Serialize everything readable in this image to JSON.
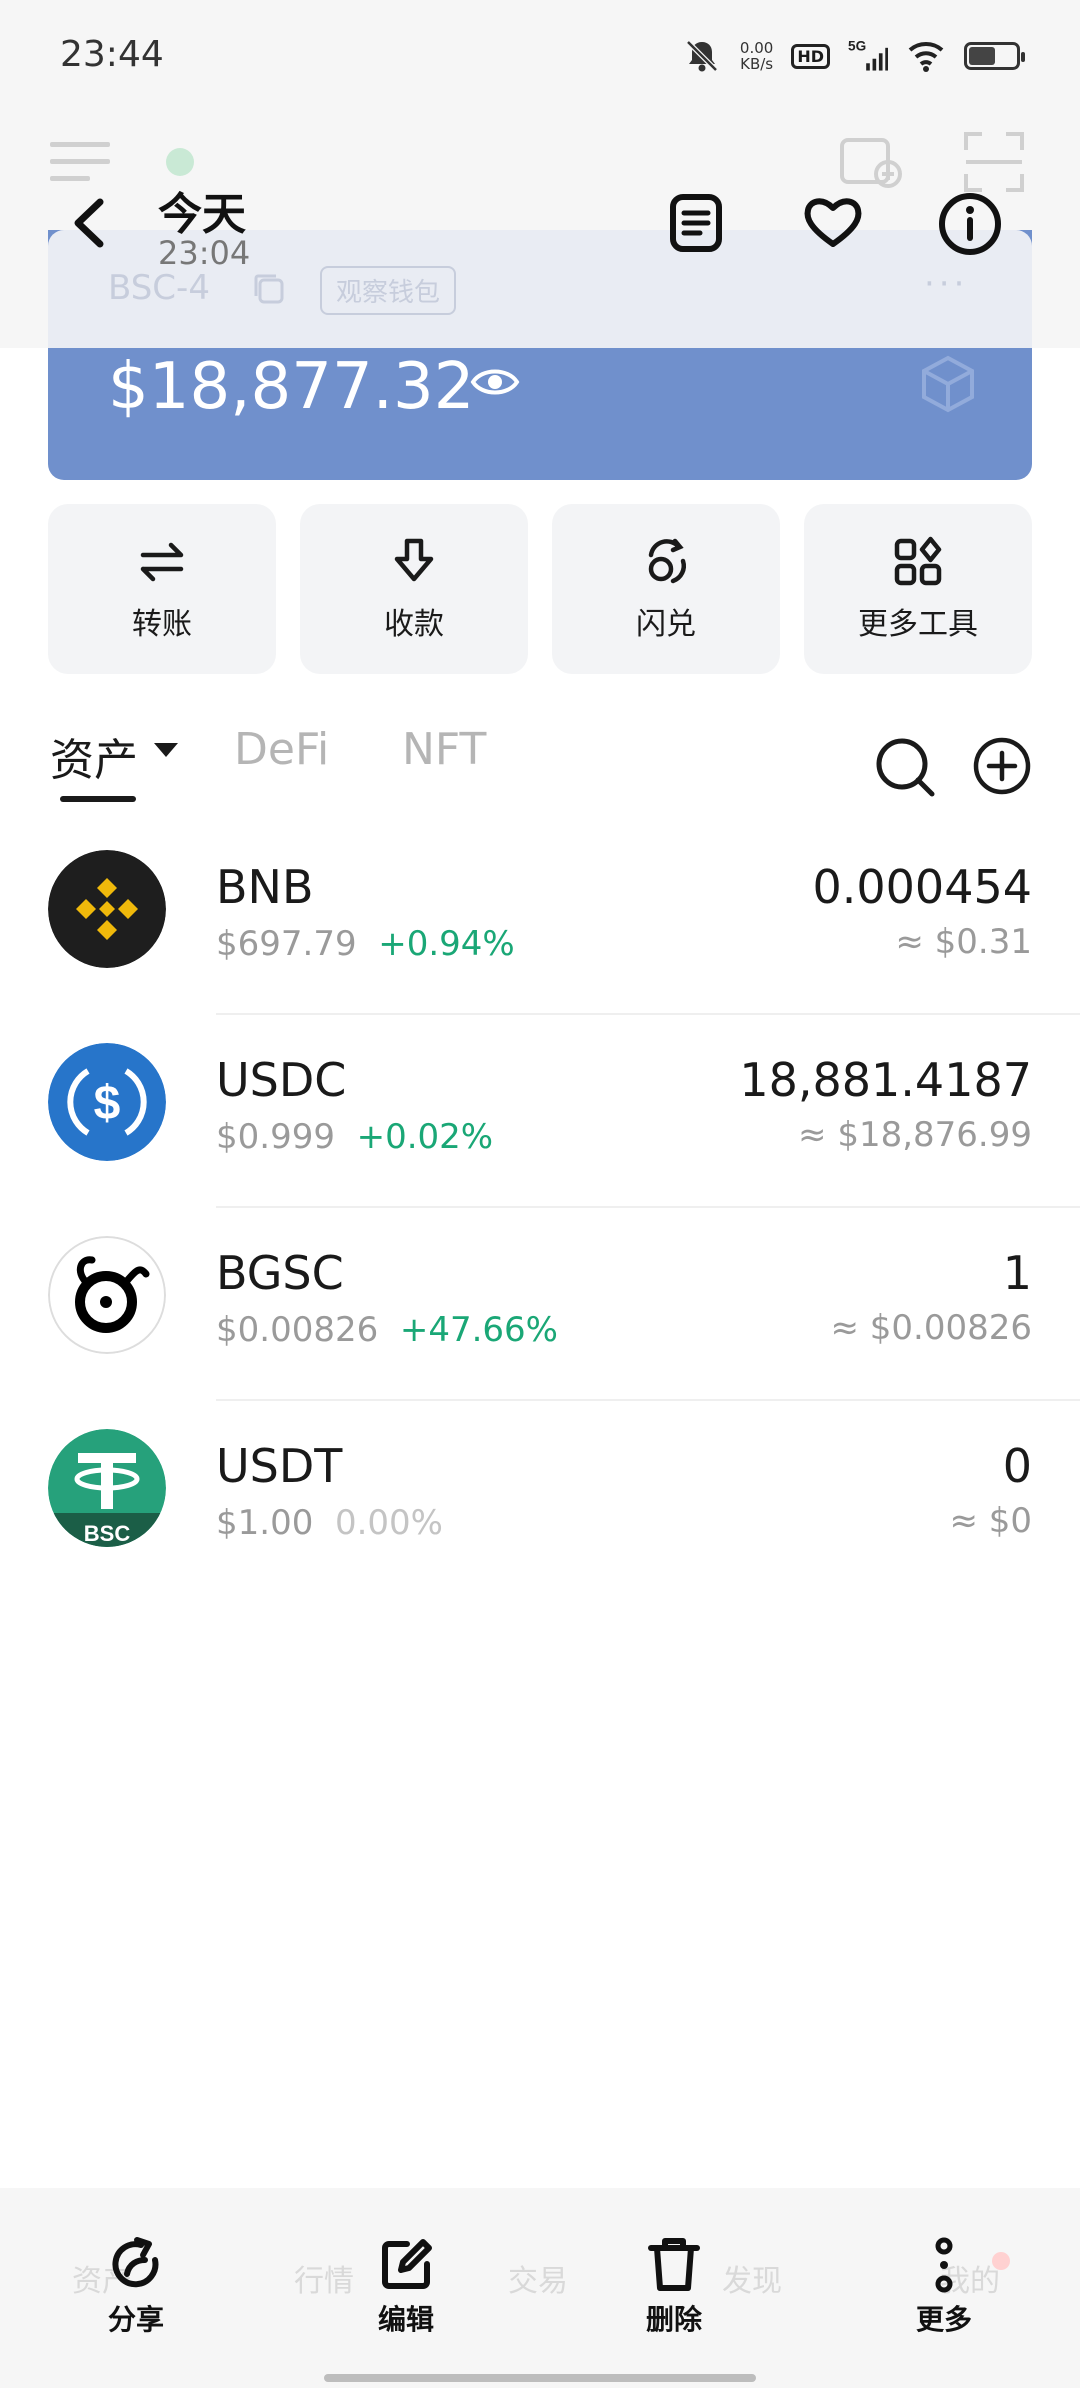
{
  "status_bar": {
    "time": "23:44",
    "net_speed_value": "0.00",
    "net_speed_unit": "KB/s",
    "hd_label": "HD",
    "network_label": "5G",
    "icons": [
      "mute-bell-icon",
      "wifi-icon",
      "battery-icon"
    ],
    "battery_level": 0.6
  },
  "overlay_header": {
    "title": "今天",
    "time": "23:04",
    "icons": [
      "back-icon",
      "note-icon",
      "heart-icon",
      "info-icon"
    ]
  },
  "wallet_card": {
    "name": "BSC-4",
    "badge": "观察钱包",
    "more": "···",
    "balance": "$18,877.32",
    "card_color": "#7090cc"
  },
  "quick_actions": [
    {
      "label": "转账",
      "icon": "transfer-icon"
    },
    {
      "label": "收款",
      "icon": "receive-icon"
    },
    {
      "label": "闪兑",
      "icon": "swap-icon"
    },
    {
      "label": "更多工具",
      "icon": "tools-grid-icon"
    }
  ],
  "tabs": {
    "assets": "资产",
    "defi": "DeFi",
    "nft": "NFT",
    "active": "assets"
  },
  "tokens": [
    {
      "symbol": "BNB",
      "price": "$697.79",
      "change": "+0.94%",
      "amount": "0.000454",
      "value": "≈ $0.31",
      "logo_color": "#1e1e1e",
      "accent": "#f0b90b"
    },
    {
      "symbol": "USDC",
      "price": "$0.999",
      "change": "+0.02%",
      "amount": "18,881.4187",
      "value": "≈ $18,876.99",
      "logo_color": "#2775ca"
    },
    {
      "symbol": "BGSC",
      "price": "$0.00826",
      "change": "+47.66%",
      "amount": "1",
      "value": "≈ $0.00826",
      "logo_color": "#ffffff"
    },
    {
      "symbol": "USDT",
      "price": "$1.00",
      "change": "0.00%",
      "amount": "0",
      "value": "≈ $0",
      "logo_color": "#26a17b",
      "logo_tag": "BSC"
    }
  ],
  "colors": {
    "positive": "#1aa776",
    "neutral": "#c4c4c4"
  },
  "bottom_bar": {
    "share": "分享",
    "edit": "编辑",
    "delete": "删除",
    "more": "更多",
    "ghost_nav": [
      "资产",
      "行情",
      "交易",
      "发现",
      "我的"
    ]
  }
}
